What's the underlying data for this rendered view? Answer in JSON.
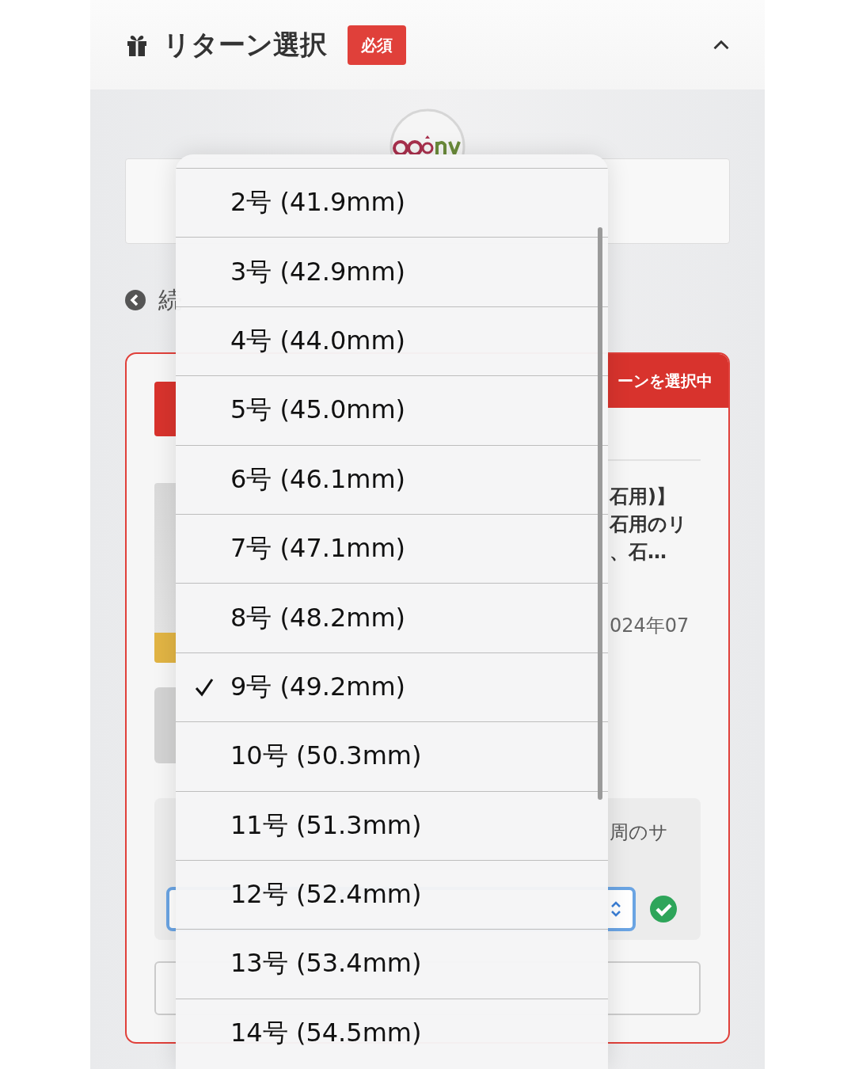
{
  "header": {
    "title": "リターン選択",
    "badge": "必須",
    "expanded": true
  },
  "back_link": {
    "label": "続"
  },
  "card": {
    "banner": "ーンを選択中",
    "title_lines": [
      "石用)】",
      "石用のリ",
      "、石…"
    ],
    "date": "024年07",
    "option_label": "周のサ",
    "valid": true
  },
  "menu": {
    "options": [
      {
        "label": "2号 (41.9mm)",
        "selected": false
      },
      {
        "label": "3号 (42.9mm)",
        "selected": false
      },
      {
        "label": "4号 (44.0mm)",
        "selected": false
      },
      {
        "label": "5号 (45.0mm)",
        "selected": false
      },
      {
        "label": "6号 (46.1mm)",
        "selected": false
      },
      {
        "label": "7号 (47.1mm)",
        "selected": false
      },
      {
        "label": "8号 (48.2mm)",
        "selected": false
      },
      {
        "label": "9号 (49.2mm)",
        "selected": true
      },
      {
        "label": "10号 (50.3mm)",
        "selected": false
      },
      {
        "label": "11号 (51.3mm)",
        "selected": false
      },
      {
        "label": "12号 (52.4mm)",
        "selected": false
      },
      {
        "label": "13号 (53.4mm)",
        "selected": false
      },
      {
        "label": "14号 (54.5mm)",
        "selected": false
      }
    ]
  }
}
